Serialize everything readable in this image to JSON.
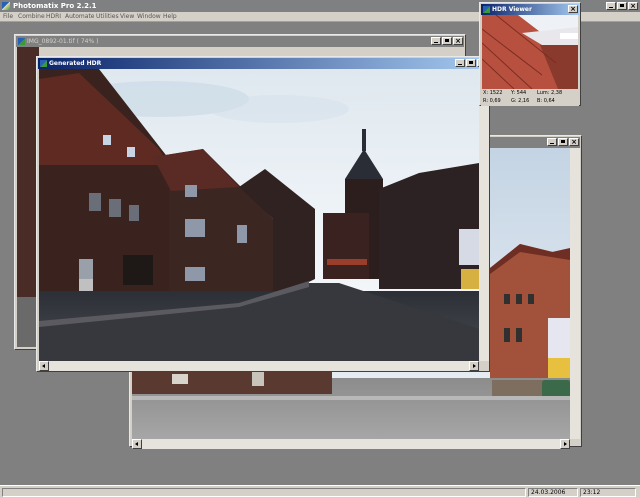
{
  "app": {
    "title": "Photomatix Pro 2.2.1",
    "menu": [
      "File",
      "Combine",
      "HDRI",
      "Automate",
      "Utilities",
      "View",
      "Window",
      "Help"
    ]
  },
  "windows": {
    "back_right": {
      "title": ""
    },
    "tif_window": {
      "title": "IMG_0892-01.tif ( 74% )"
    },
    "generated_hdr": {
      "title": "Generated HDR"
    },
    "hdr_viewer": {
      "title": "HDR Viewer",
      "readouts": {
        "x": "X: 1522",
        "y": "Y: 544",
        "lum": "Lum: 2,38",
        "r": "R: 0,69",
        "g": "G: 2,16",
        "b": "B: 0,64"
      }
    }
  },
  "statusbar": {
    "date": "24.03.2006",
    "time": "23:12"
  },
  "colors": {
    "workspace": "#808080",
    "chrome": "#d4d0c8",
    "active_title_start": "#0a246a",
    "active_title_end": "#a6caf0",
    "inactive_title": "#808080"
  },
  "icons": [
    "app-icon",
    "document-icon",
    "minimize-icon",
    "maximize-icon",
    "close-icon",
    "scroll-left-icon",
    "scroll-right-icon"
  ]
}
